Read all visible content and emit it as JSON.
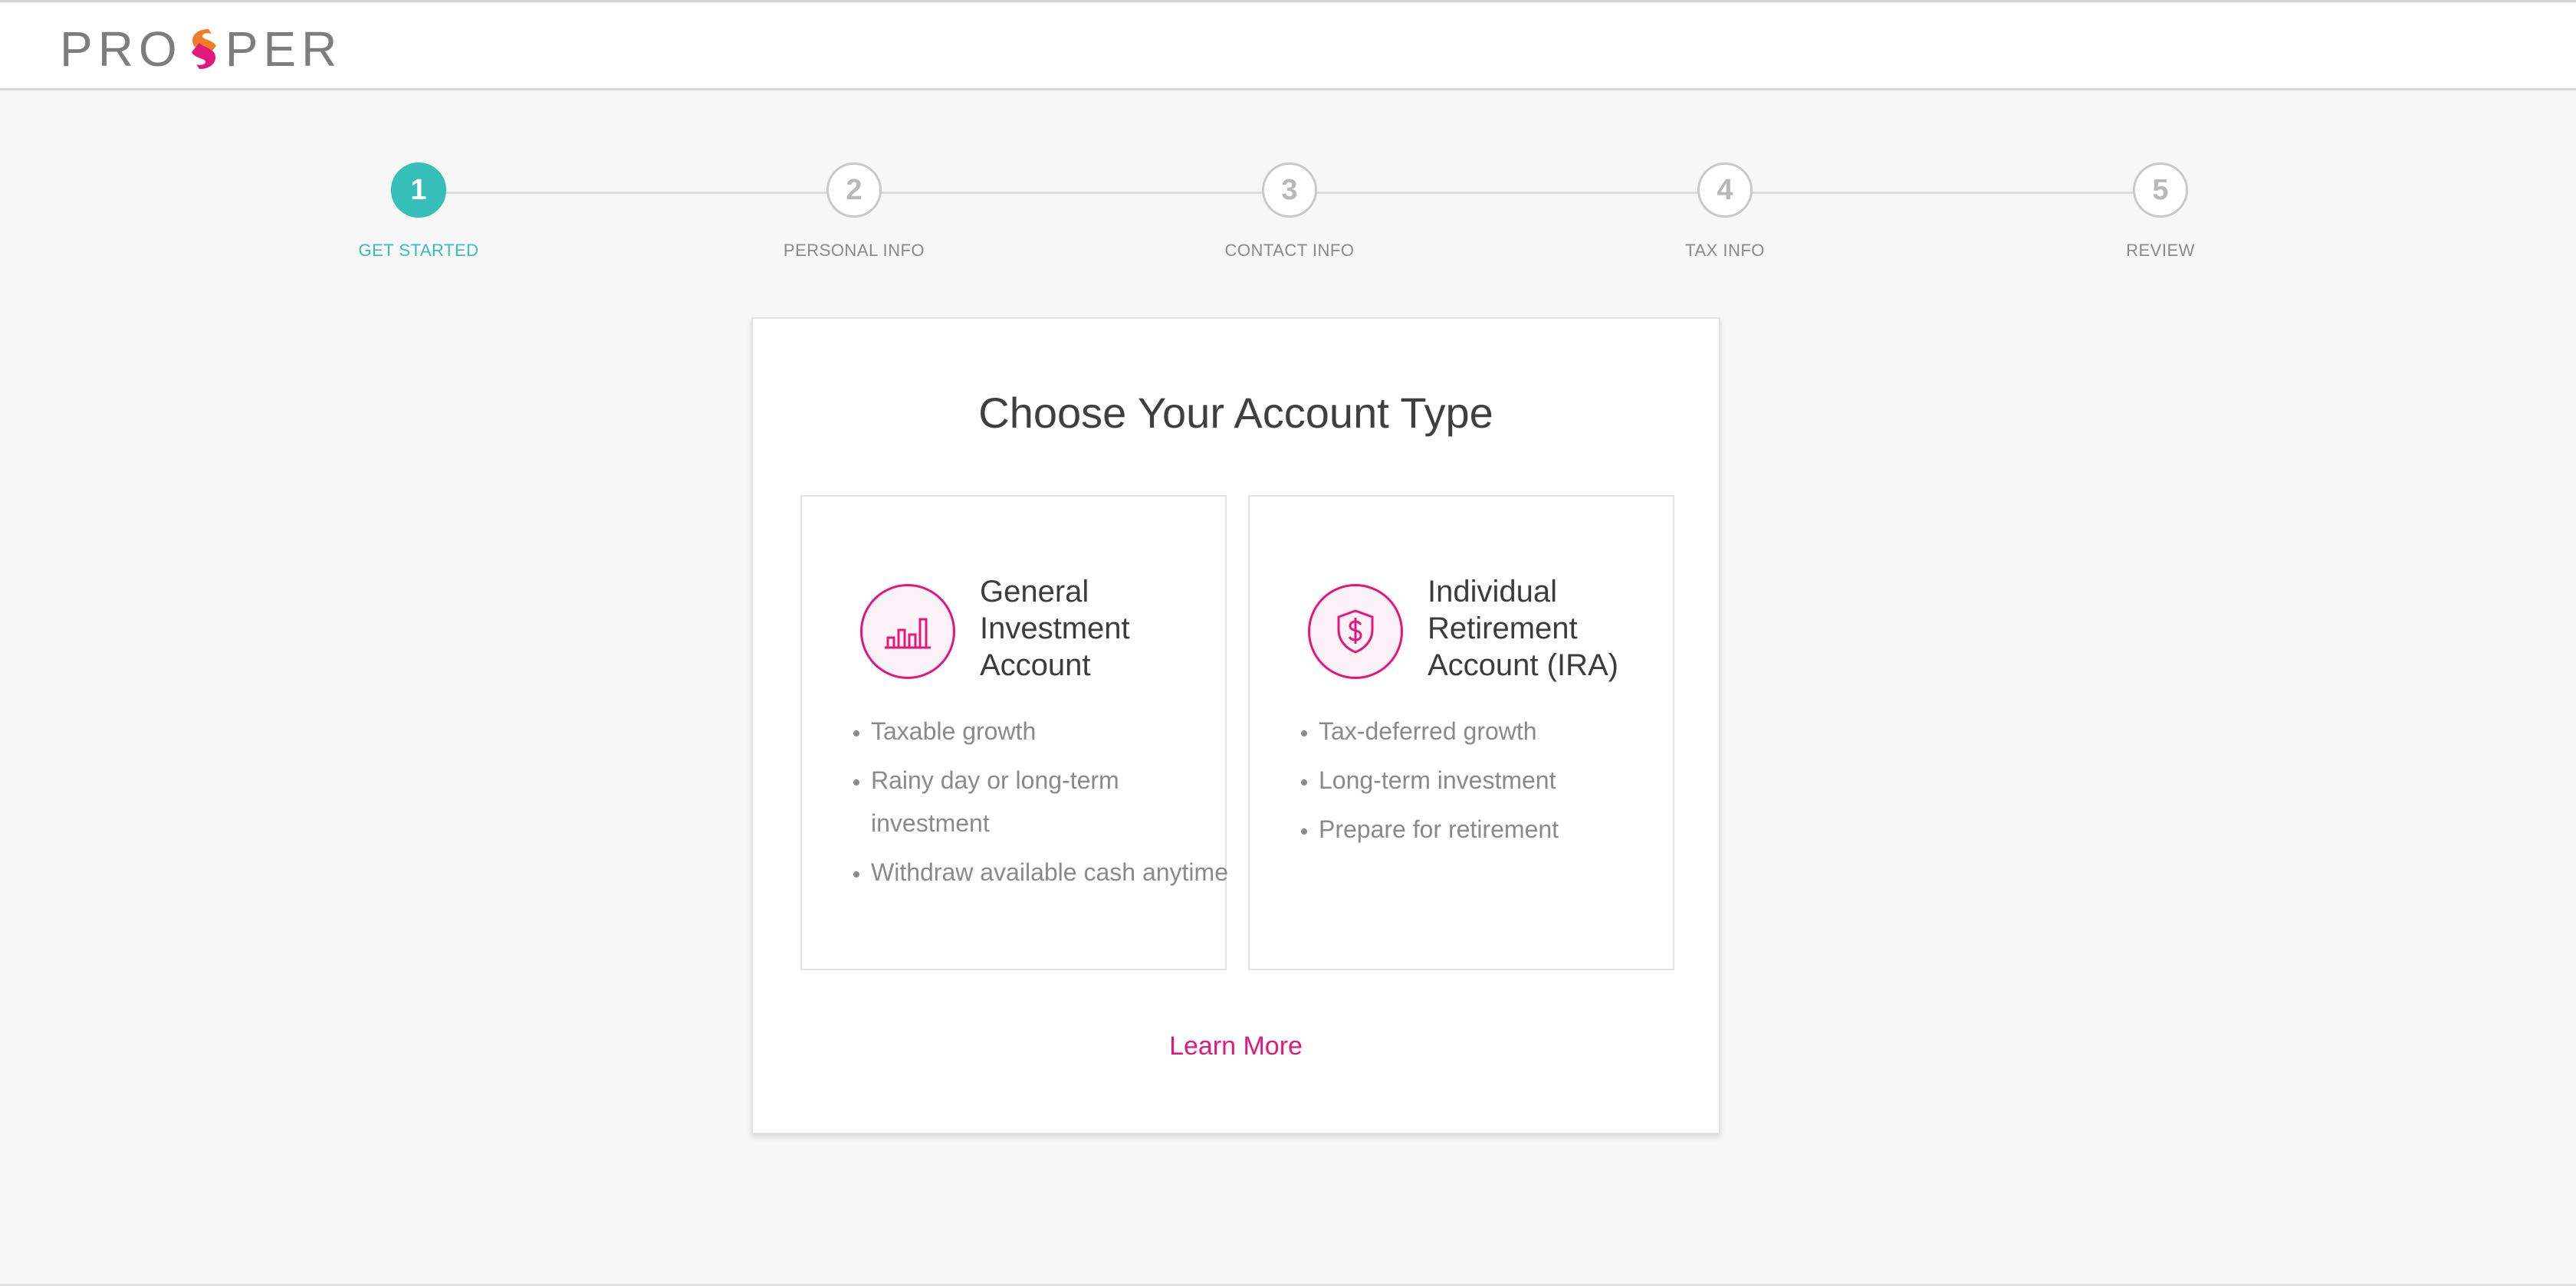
{
  "header": {
    "logo_text_left": "PRO",
    "logo_text_right": "PER",
    "logo_mark_icon": "prosper-s-mark-icon"
  },
  "stepper": {
    "steps": [
      {
        "number": "1",
        "label": "GET STARTED",
        "active": true
      },
      {
        "number": "2",
        "label": "PERSONAL INFO",
        "active": false
      },
      {
        "number": "3",
        "label": "CONTACT INFO",
        "active": false
      },
      {
        "number": "4",
        "label": "TAX INFO",
        "active": false
      },
      {
        "number": "5",
        "label": "REVIEW",
        "active": false
      }
    ],
    "active_color": "#35bfb8"
  },
  "main": {
    "title": "Choose Your Account Type",
    "cards": [
      {
        "icon": "bar-chart-icon",
        "title_lines": [
          "General",
          "Investment",
          "Account"
        ],
        "bullets": [
          "Taxable growth",
          "Rainy day or long-term investment",
          "Withdraw available cash anytime"
        ]
      },
      {
        "icon": "dollar-shield-icon",
        "title_lines": [
          "Individual",
          "Retirement",
          "Account (IRA)"
        ],
        "bullets": [
          "Tax-deferred growth",
          "Long-term investment",
          "Prepare for retirement"
        ]
      }
    ],
    "learn_more": "Learn More",
    "accent_color": "#e2197a"
  }
}
